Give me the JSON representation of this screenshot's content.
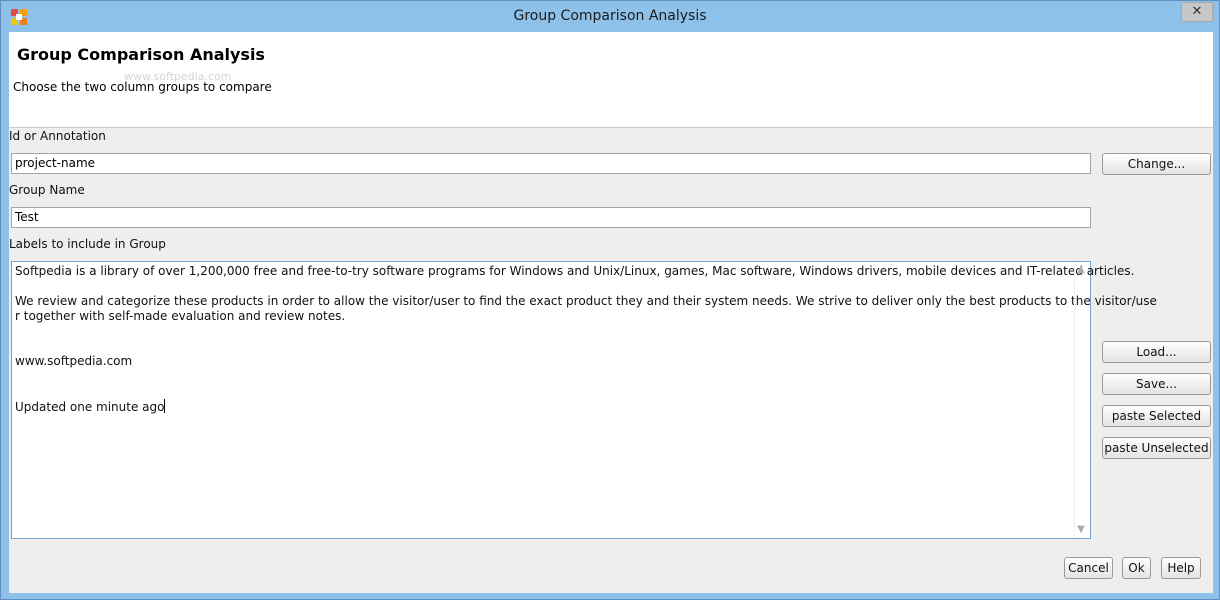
{
  "window": {
    "title": "Group Comparison Analysis",
    "close_glyph": "✕"
  },
  "header": {
    "title": "Group Comparison Analysis",
    "watermark": "www.softpedia.com",
    "subtitle": "Choose the two column groups to compare"
  },
  "form": {
    "id_label": "Id or Annotation",
    "id_value": "project-name",
    "change_button": "Change...",
    "group_name_label": "Group Name",
    "group_name_value": "Test",
    "labels_label": "Labels to include in Group",
    "labels_lines": [
      "Softpedia is a library of over 1,200,000 free and free-to-try software programs for Windows and Unix/Linux, games, Mac software, Windows drivers, mobile devices and IT-related articles.",
      "",
      "We review and categorize these products in order to allow the visitor/user to find the exact product they and their system needs. We strive to deliver only the best products to the visitor/use",
      "r together with self-made evaluation and review notes.",
      "",
      "",
      "www.softpedia.com",
      "",
      "",
      "Updated one minute ago"
    ]
  },
  "side_buttons": {
    "load": "Load...",
    "save": "Save...",
    "paste_selected": "paste Selected",
    "paste_unselected": "paste Unselected"
  },
  "footer_buttons": {
    "cancel": "Cancel",
    "ok": "Ok",
    "help": "Help"
  },
  "scroll_glyphs": {
    "up": "▲",
    "down": "▼"
  },
  "colors": {
    "titlebar": "#8ec1e9",
    "dialog_bg": "#eeeeee",
    "textarea_border": "#7aa1d2"
  }
}
